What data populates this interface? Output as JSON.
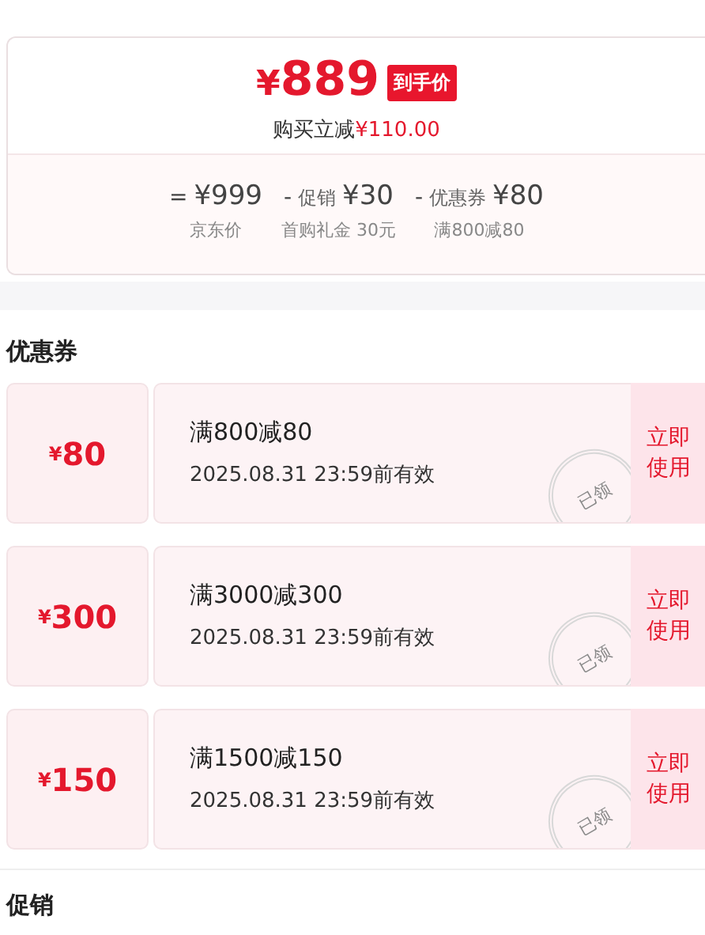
{
  "price_card": {
    "currency": "¥",
    "price": "889",
    "price_tag": "到手价",
    "saving_label": "购买立减",
    "saving_amount": "¥110.00",
    "breakdown": [
      {
        "operator": "=",
        "amount": "¥999",
        "note": "京东价"
      },
      {
        "operator": "-",
        "label": "促销",
        "amount": "¥30",
        "note": "首购礼金 30元"
      },
      {
        "operator": "-",
        "label": "优惠券",
        "amount": "¥80",
        "note": "满800减80"
      }
    ]
  },
  "coupons_section": {
    "title": "优惠券",
    "coupons": [
      {
        "currency": "¥",
        "value": "80",
        "condition": "满800减80",
        "validity": "2025.08.31 23:59前有效",
        "stamp": "已领",
        "action": "立即使用"
      },
      {
        "currency": "¥",
        "value": "300",
        "condition": "满3000减300",
        "validity": "2025.08.31 23:59前有效",
        "stamp": "已领",
        "action": "立即使用"
      },
      {
        "currency": "¥",
        "value": "150",
        "condition": "满1500减150",
        "validity": "2025.08.31 23:59前有效",
        "stamp": "已领",
        "action": "立即使用"
      }
    ]
  },
  "promotions_section": {
    "title": "促销"
  }
}
